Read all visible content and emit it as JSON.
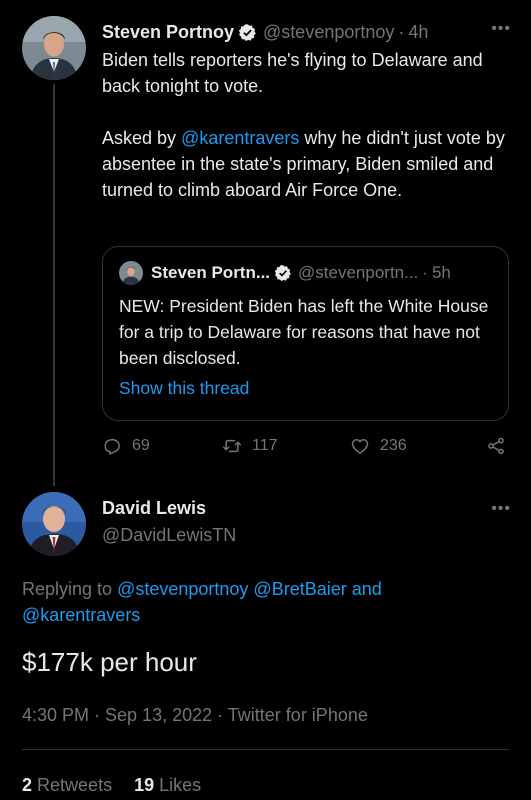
{
  "main_tweet": {
    "author_name": "Steven Portnoy",
    "author_handle": "@stevenportnoy",
    "time": "4h",
    "body_line1": "Biden tells reporters he's flying to Delaware and back tonight to vote.",
    "body2_prefix": "Asked by ",
    "body2_mention": "@karentravers",
    "body2_suffix": " why he didn't just vote by absentee in the state's primary, Biden smiled and turned to climb aboard Air Force One.",
    "more_label": "•••"
  },
  "quoted_tweet": {
    "author_name": "Steven Portn...",
    "author_handle": "@stevenportn...",
    "time": "5h",
    "body": "NEW: President Biden has left the White House for a trip to Delaware for reasons that have not been disclosed.",
    "show_thread": "Show this thread"
  },
  "actions": {
    "replies": "69",
    "retweets": "117",
    "likes": "236"
  },
  "reply_tweet": {
    "author_name": "David Lewis",
    "author_handle": "@DavidLewisTN",
    "more_label": "•••",
    "replying_prefix": "Replying to ",
    "replying_to_1": "@stevenportnoy",
    "replying_to_2": "@BretBaier",
    "replying_and": " and",
    "replying_to_3": "@karentravers",
    "text": "$177k per hour",
    "timestamp": "4:30 PM · Sep 13, 2022 · Twitter for iPhone",
    "retweet_count": "2",
    "retweet_label": "Retweets",
    "like_count": "19",
    "like_label": "Likes"
  },
  "colors": {
    "background": "#000000",
    "text": "#e7e9ea",
    "secondary": "#71767b",
    "link": "#1d9bf0",
    "border": "#2f3336"
  },
  "icons": [
    "verified-badge-icon",
    "more-icon",
    "reply-icon",
    "retweet-icon",
    "like-icon",
    "share-icon"
  ]
}
